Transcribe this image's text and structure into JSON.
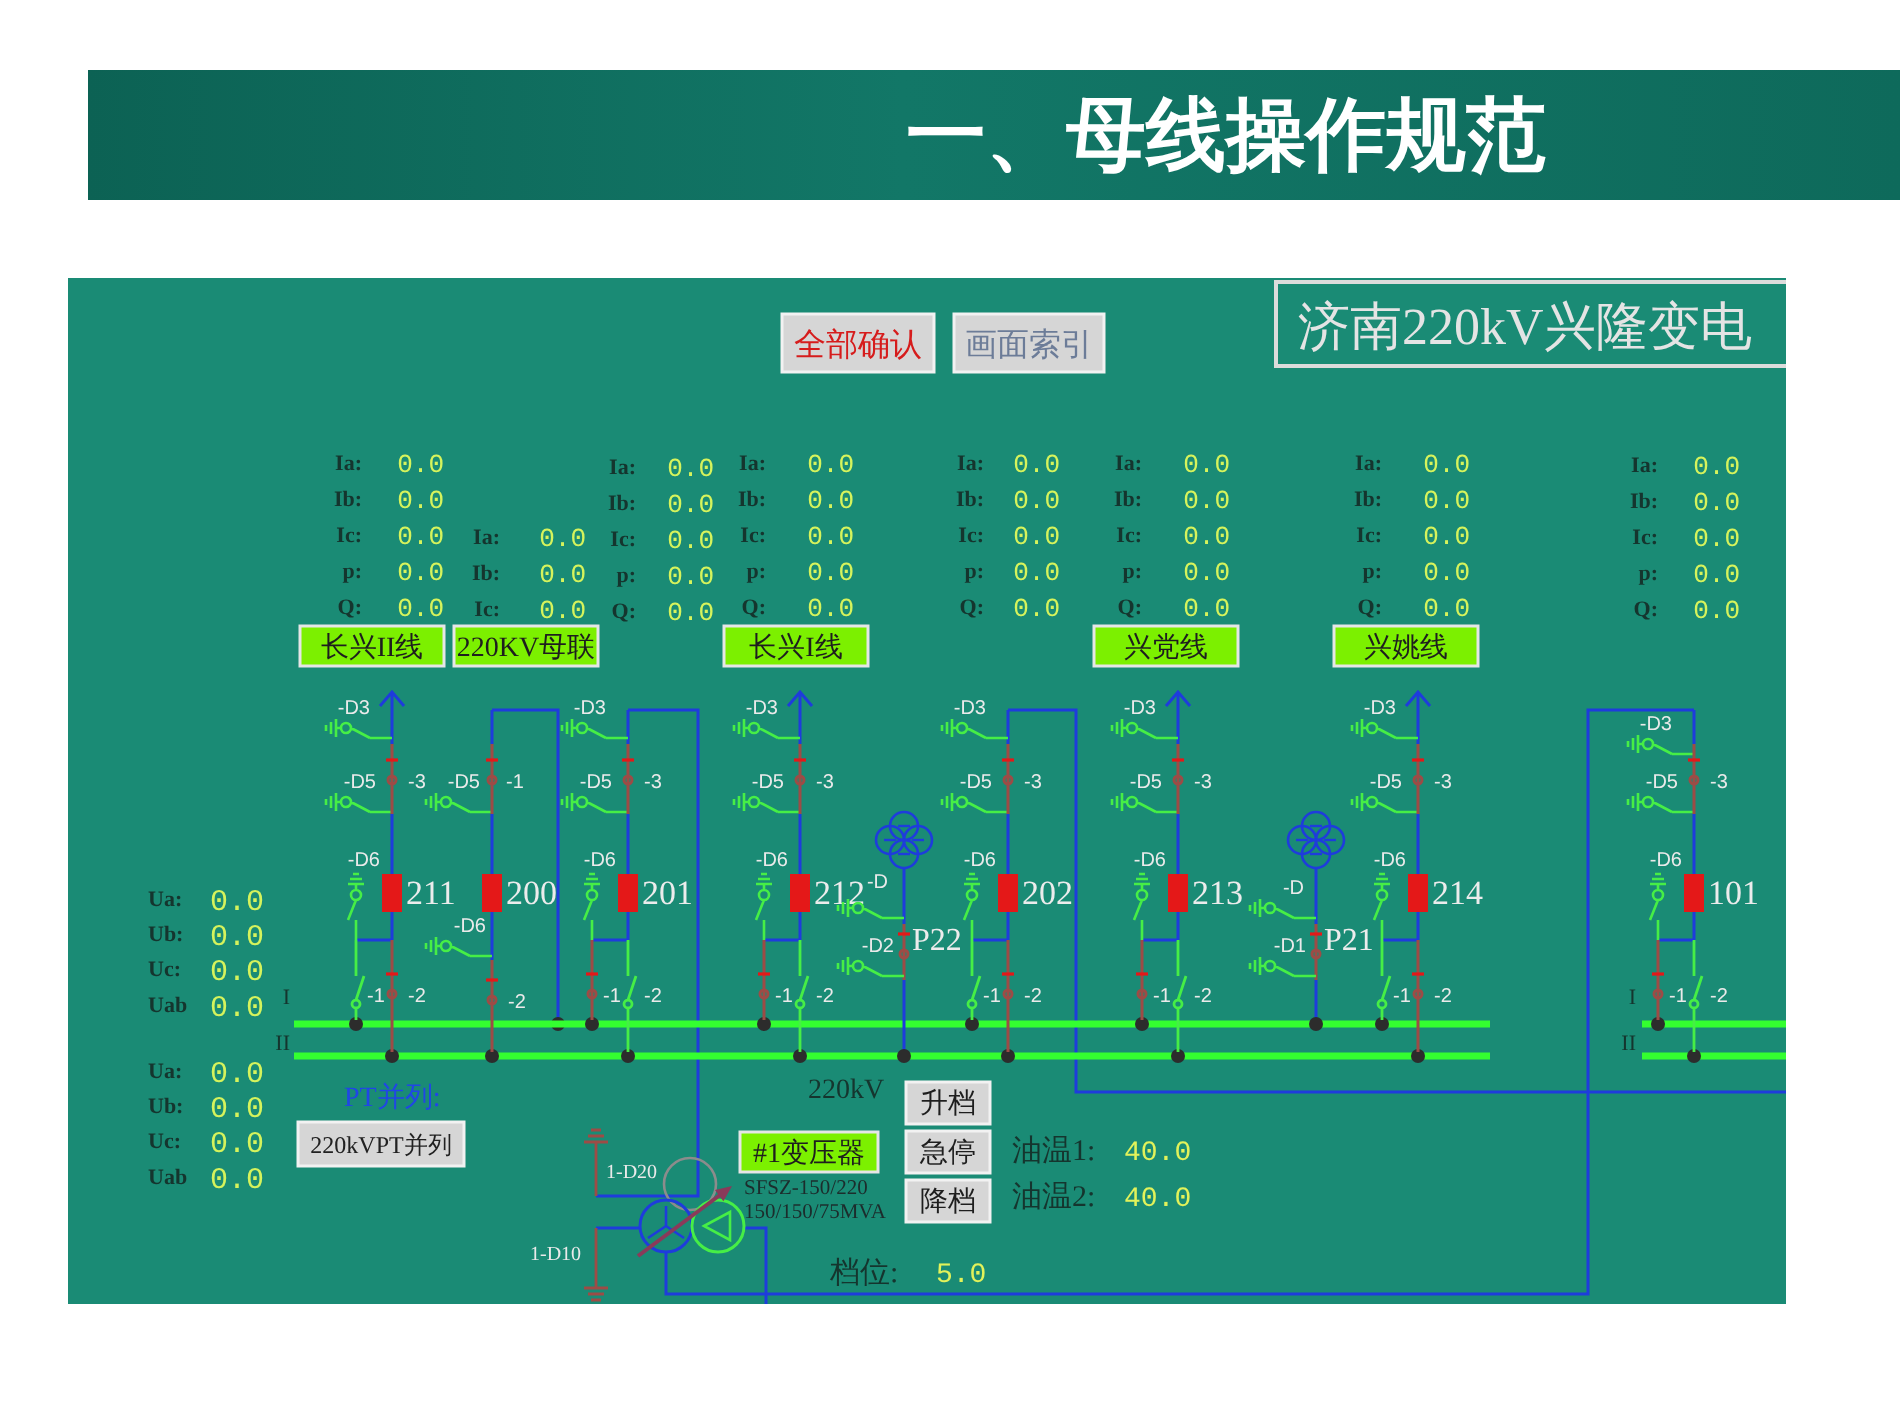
{
  "header": {
    "title": "一、母线操作规范"
  },
  "panel": {
    "buttons": [
      {
        "label": "全部确认",
        "kind": "alarm"
      },
      {
        "label": "画面索引",
        "kind": "plain"
      }
    ],
    "station_title": "济南220kV兴隆变电",
    "bays": [
      {
        "kind": "feeder",
        "number": "211",
        "breaker_closed": true,
        "readings": [
          {
            "label": "Ia:",
            "value": "0.0"
          },
          {
            "label": "Ib:",
            "value": "0.0"
          },
          {
            "label": "Ic:",
            "value": "0.0"
          },
          {
            "label": "p:",
            "value": "0.0"
          },
          {
            "label": "Q:",
            "value": "0.0"
          }
        ],
        "line_name": "长兴II线",
        "switches": [
          {
            "kind": "ground",
            "label": "-D3",
            "closed": false
          },
          {
            "kind": "ground",
            "label": "-D5",
            "closed": false
          },
          {
            "kind": "disconnector",
            "label": "-3",
            "closed": true
          },
          {
            "kind": "ground",
            "label": "-D6",
            "closed": false
          },
          {
            "kind": "disconnector",
            "label": "-1",
            "closed": false
          },
          {
            "kind": "disconnector",
            "label": "-2",
            "closed": true
          }
        ]
      },
      {
        "kind": "coupler",
        "number": "200",
        "breaker_closed": true,
        "readings": [
          {
            "label": "Ia:",
            "value": "0.0"
          },
          {
            "label": "Ib:",
            "value": "0.0"
          },
          {
            "label": "Ic:",
            "value": "0.0"
          }
        ],
        "line_name": "220KV母联",
        "switches": [
          {
            "kind": "ground",
            "label": "-D5",
            "closed": false
          },
          {
            "kind": "disconnector",
            "label": "-1",
            "closed": true
          },
          {
            "kind": "ground",
            "label": "-D6",
            "closed": false
          },
          {
            "kind": "disconnector",
            "label": "-2",
            "closed": true
          }
        ]
      },
      {
        "kind": "link",
        "number": "201",
        "breaker_closed": true,
        "readings": [
          {
            "label": "Ia:",
            "value": "0.0"
          },
          {
            "label": "Ib:",
            "value": "0.0"
          },
          {
            "label": "Ic:",
            "value": "0.0"
          },
          {
            "label": "p:",
            "value": "0.0"
          },
          {
            "label": "Q:",
            "value": "0.0"
          }
        ],
        "switches": [
          {
            "kind": "ground",
            "label": "-D3",
            "closed": false
          },
          {
            "kind": "ground",
            "label": "-D5",
            "closed": false
          },
          {
            "kind": "disconnector",
            "label": "-3",
            "closed": true
          },
          {
            "kind": "ground",
            "label": "-D6",
            "closed": false
          },
          {
            "kind": "disconnector",
            "label": "-1",
            "closed": true
          },
          {
            "kind": "disconnector",
            "label": "-2",
            "closed": false
          }
        ]
      },
      {
        "kind": "feeder",
        "number": "212",
        "breaker_closed": true,
        "readings": [
          {
            "label": "Ia:",
            "value": "0.0"
          },
          {
            "label": "Ib:",
            "value": "0.0"
          },
          {
            "label": "Ic:",
            "value": "0.0"
          },
          {
            "label": "p:",
            "value": "0.0"
          },
          {
            "label": "Q:",
            "value": "0.0"
          }
        ],
        "line_name": "长兴I线",
        "switches": [
          {
            "kind": "ground",
            "label": "-D3",
            "closed": false
          },
          {
            "kind": "ground",
            "label": "-D5",
            "closed": false
          },
          {
            "kind": "disconnector",
            "label": "-3",
            "closed": true
          },
          {
            "kind": "ground",
            "label": "-D6",
            "closed": false
          },
          {
            "kind": "disconnector",
            "label": "-1",
            "closed": true
          },
          {
            "kind": "disconnector",
            "label": "-2",
            "closed": false
          }
        ]
      },
      {
        "kind": "pt",
        "number": "P22",
        "switches": [
          {
            "kind": "ground",
            "label": "-D",
            "closed": false
          },
          {
            "kind": "disconnector",
            "closed": true
          },
          {
            "kind": "ground",
            "label": "-D2",
            "closed": false
          }
        ]
      },
      {
        "kind": "link",
        "number": "202",
        "breaker_closed": true,
        "readings": [
          {
            "label": "Ia:",
            "value": "0.0"
          },
          {
            "label": "Ib:",
            "value": "0.0"
          },
          {
            "label": "Ic:",
            "value": "0.0"
          },
          {
            "label": "p:",
            "value": "0.0"
          },
          {
            "label": "Q:",
            "value": "0.0"
          }
        ],
        "switches": [
          {
            "kind": "ground",
            "label": "-D3",
            "closed": false
          },
          {
            "kind": "ground",
            "label": "-D5",
            "closed": false
          },
          {
            "kind": "disconnector",
            "label": "-3",
            "closed": true
          },
          {
            "kind": "ground",
            "label": "-D6",
            "closed": false
          },
          {
            "kind": "disconnector",
            "label": "-1",
            "closed": false
          },
          {
            "kind": "disconnector",
            "label": "-2",
            "closed": true
          }
        ]
      },
      {
        "kind": "feeder",
        "number": "213",
        "breaker_closed": true,
        "readings": [
          {
            "label": "Ia:",
            "value": "0.0"
          },
          {
            "label": "Ib:",
            "value": "0.0"
          },
          {
            "label": "Ic:",
            "value": "0.0"
          },
          {
            "label": "p:",
            "value": "0.0"
          },
          {
            "label": "Q:",
            "value": "0.0"
          }
        ],
        "line_name": "兴党线",
        "switches": [
          {
            "kind": "ground",
            "label": "-D3",
            "closed": false
          },
          {
            "kind": "ground",
            "label": "-D5",
            "closed": false
          },
          {
            "kind": "disconnector",
            "label": "-3",
            "closed": true
          },
          {
            "kind": "ground",
            "label": "-D6",
            "closed": false
          },
          {
            "kind": "disconnector",
            "label": "-1",
            "closed": true
          },
          {
            "kind": "disconnector",
            "label": "-2",
            "closed": false
          }
        ]
      },
      {
        "kind": "pt",
        "number": "P21",
        "switches": [
          {
            "kind": "ground",
            "label": "-D",
            "closed": false
          },
          {
            "kind": "disconnector",
            "closed": true
          },
          {
            "kind": "ground",
            "label": "-D1",
            "closed": false
          }
        ]
      },
      {
        "kind": "feeder",
        "number": "214",
        "breaker_closed": true,
        "readings": [
          {
            "label": "Ia:",
            "value": "0.0"
          },
          {
            "label": "Ib:",
            "value": "0.0"
          },
          {
            "label": "Ic:",
            "value": "0.0"
          },
          {
            "label": "p:",
            "value": "0.0"
          },
          {
            "label": "Q:",
            "value": "0.0"
          }
        ],
        "line_name": "兴姚线",
        "switches": [
          {
            "kind": "ground",
            "label": "-D3",
            "closed": false
          },
          {
            "kind": "ground",
            "label": "-D5",
            "closed": false
          },
          {
            "kind": "disconnector",
            "label": "-3",
            "closed": true
          },
          {
            "kind": "ground",
            "label": "-D6",
            "closed": false
          },
          {
            "kind": "disconnector",
            "label": "-1",
            "closed": false
          },
          {
            "kind": "disconnector",
            "label": "-2",
            "closed": true
          }
        ]
      },
      {
        "kind": "link",
        "number": "101",
        "breaker_closed": true,
        "readings": [
          {
            "label": "Ia:",
            "value": "0.0"
          },
          {
            "label": "Ib:",
            "value": "0.0"
          },
          {
            "label": "Ic:",
            "value": "0.0"
          },
          {
            "label": "p:",
            "value": "0.0"
          },
          {
            "label": "Q:",
            "value": "0.0"
          }
        ],
        "switches": [
          {
            "kind": "ground",
            "label": "-D3",
            "closed": false
          },
          {
            "kind": "ground",
            "label": "-D5",
            "closed": false
          },
          {
            "kind": "disconnector",
            "label": "-3",
            "closed": true
          },
          {
            "kind": "ground",
            "label": "-D6",
            "closed": false
          },
          {
            "kind": "disconnector",
            "label": "-1",
            "closed": true
          },
          {
            "kind": "disconnector",
            "label": "-2",
            "closed": false
          }
        ]
      }
    ],
    "buses": [
      {
        "label": "I"
      },
      {
        "label": "II"
      }
    ],
    "right_buses": [
      {
        "label": "I"
      },
      {
        "label": "II"
      }
    ],
    "voltage_groups": [
      {
        "rows": [
          {
            "label": "Ua:",
            "value": "0.0"
          },
          {
            "label": "Ub:",
            "value": "0.0"
          },
          {
            "label": "Uc:",
            "value": "0.0"
          },
          {
            "label": "Uab",
            "value": "0.0"
          }
        ]
      },
      {
        "rows": [
          {
            "label": "Ua:",
            "value": "0.0"
          },
          {
            "label": "Ub:",
            "value": "0.0"
          },
          {
            "label": "Uc:",
            "value": "0.0"
          },
          {
            "label": "Uab",
            "value": "0.0"
          }
        ]
      }
    ],
    "pt_parallel": {
      "label": "PT并列:",
      "button": "220kVPT并列"
    },
    "transformer": {
      "voltage_level": "220kV",
      "controls": [
        {
          "label": "升档"
        },
        {
          "label": "急停"
        },
        {
          "label": "降档"
        }
      ],
      "name": "#1变压器",
      "model": "SFSZ-150/220",
      "rating": "150/150/75MVA",
      "oil_temps": [
        {
          "label": "油温1:",
          "value": "40.0"
        },
        {
          "label": "油温2:",
          "value": "40.0"
        }
      ],
      "tap_position": {
        "label": "档位:",
        "value": "5.0"
      },
      "ground_switches": [
        {
          "label": "1-D20"
        },
        {
          "label": "1-D10"
        }
      ]
    }
  }
}
